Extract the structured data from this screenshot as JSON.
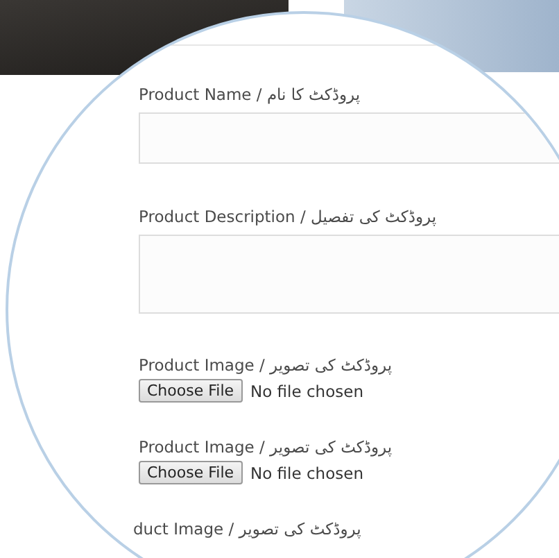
{
  "fields": [
    {
      "kind": "text",
      "label": "Product Name / پروڈکٹ کا نام"
    },
    {
      "kind": "textarea",
      "label": "Product Description / پروڈکٹ کی تفصیل"
    },
    {
      "kind": "file",
      "label": "Product Image / پروڈکٹ کی تصویر",
      "button": "Choose File",
      "status": "No file chosen"
    },
    {
      "kind": "file",
      "label": "Product Image / پروڈکٹ کی تصویر",
      "button": "Choose File",
      "status": "No file chosen"
    },
    {
      "kind": "label",
      "label": "duct Image / پروڈکٹ کی تصویر"
    }
  ]
}
